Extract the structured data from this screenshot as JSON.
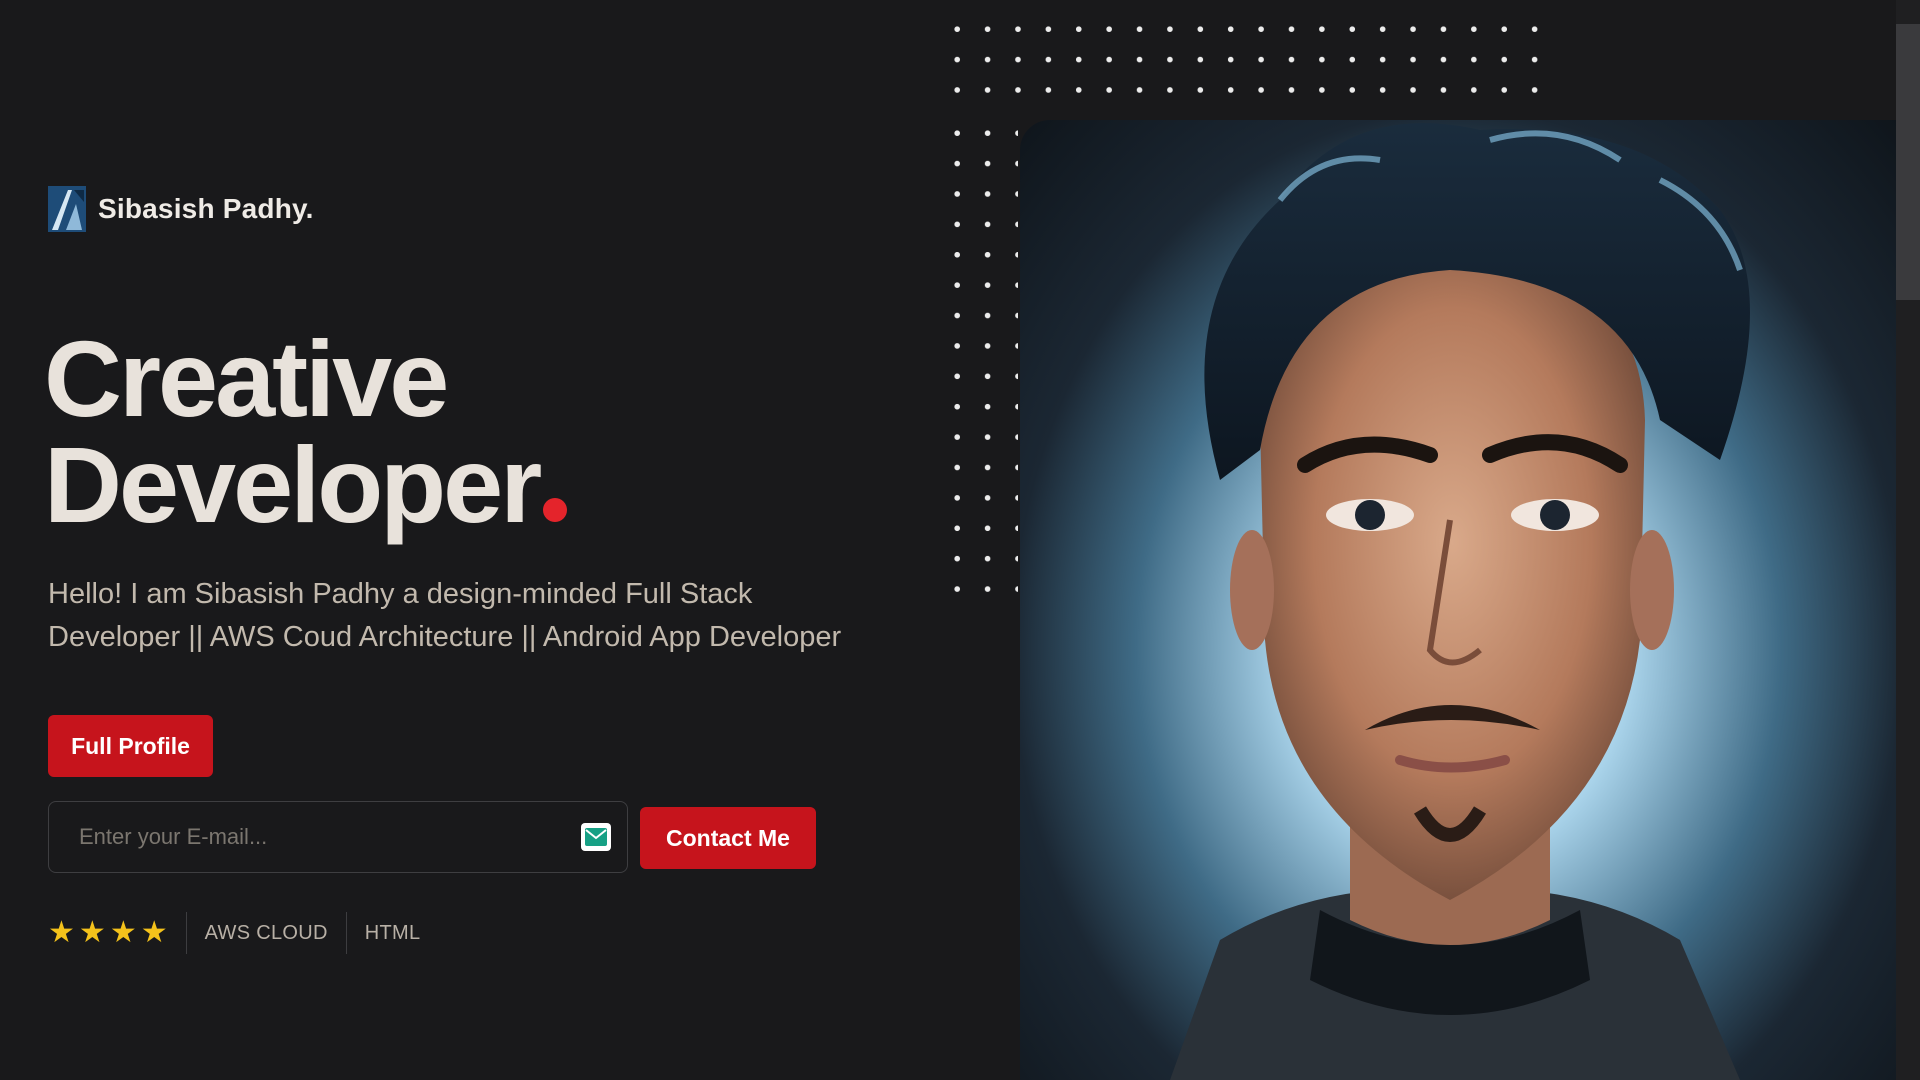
{
  "brand": {
    "name": "Sibasish Padhy."
  },
  "hero": {
    "headline_line1": "Creative",
    "headline_line2": "Developer",
    "intro": "Hello! I am Sibasish Padhy a design-minded Full Stack Developer || AWS Coud Architecture || Android App Developer"
  },
  "actions": {
    "full_profile_label": "Full Profile",
    "contact_label": "Contact Me"
  },
  "email": {
    "placeholder": "Enter your E-mail...",
    "value": ""
  },
  "skills": {
    "rating": 4,
    "rating_max": 4,
    "tags": [
      "AWS CLOUD",
      "HTML"
    ]
  },
  "icons": [
    "brand-logo-icon",
    "mail-icon",
    "star-icon"
  ],
  "colors": {
    "background": "#19191b",
    "accent": "#c6141c",
    "accent_dot": "#e4242b",
    "star": "#f4c21b",
    "text": "#e8e2db"
  }
}
